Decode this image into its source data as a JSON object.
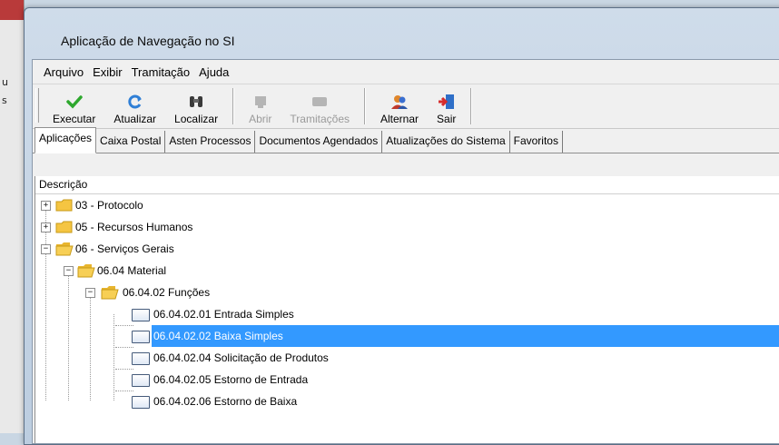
{
  "background_app": {
    "snippets": [
      "u",
      "s"
    ]
  },
  "window": {
    "title": "Aplicação de Navegação no SI"
  },
  "menu": [
    "Arquivo",
    "Exibir",
    "Tramitação",
    "Ajuda"
  ],
  "toolbar": {
    "executar": "Executar",
    "atualizar": "Atualizar",
    "localizar": "Localizar",
    "abrir": "Abrir",
    "tramitacoes": "Tramitações",
    "alternar": "Alternar",
    "sair": "Sair"
  },
  "tabs": [
    "Aplicações",
    "Caixa Postal",
    "Asten Processos",
    "Documentos Agendados",
    "Atualizações do Sistema",
    "Favoritos"
  ],
  "tree": {
    "column_header": "Descrição",
    "items": [
      "03 - Protocolo",
      "05 - Recursos Humanos",
      "06 - Serviços Gerais",
      "06.04 Material",
      "06.04.02 Funções",
      "06.04.02.01 Entrada Simples",
      "06.04.02.02 Baixa Simples",
      "06.04.02.04 Solicitação de Produtos",
      "06.04.02.05 Estorno de Entrada",
      "06.04.02.06 Estorno de Baixa"
    ]
  },
  "colors": {
    "selection": "#3399ff",
    "folder": "#f5c542"
  }
}
